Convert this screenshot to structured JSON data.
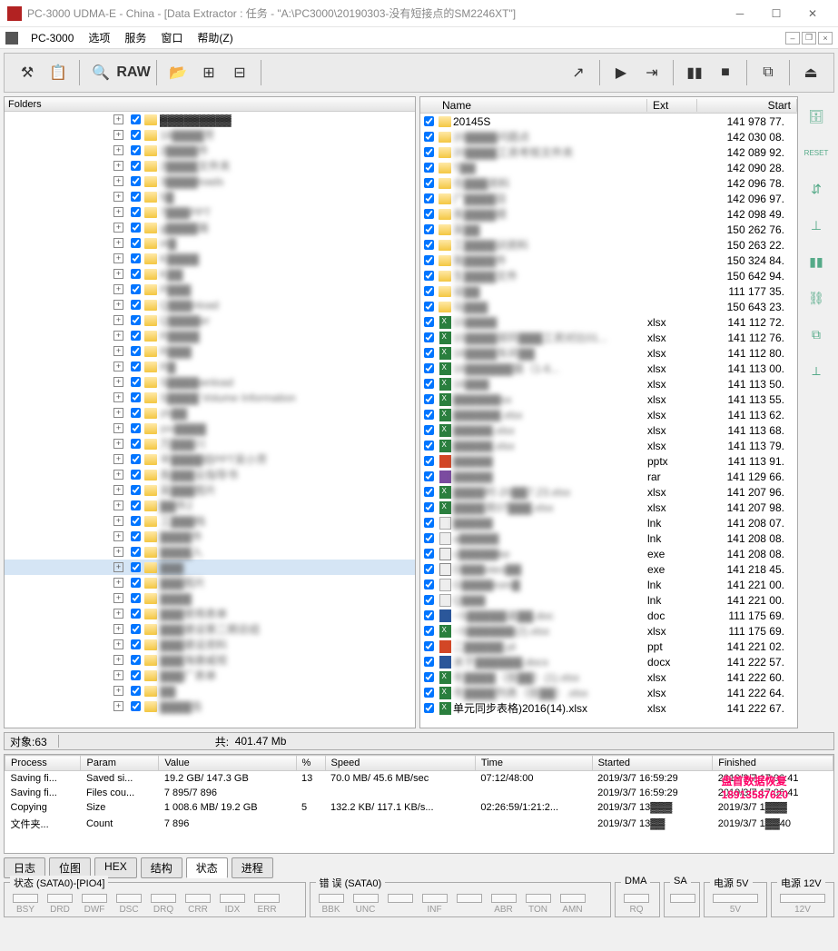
{
  "window": {
    "title": "PC-3000 UDMA-E - China - [Data Extractor : 任务 - \"A:\\PC3000\\20190303-没有短接点的SM2246XT\"]",
    "app_name": "PC-3000"
  },
  "menu": {
    "items": [
      "选项",
      "服务",
      "窗口",
      "帮助(Z)"
    ]
  },
  "toolbar": {
    "raw": "RAW"
  },
  "left_pane": {
    "header": "Folders",
    "rows": [
      {
        "label": "▓▓▓▓▓▓▓▓▓",
        "blur_label": "▓▓年同▓▓▓▓"
      },
      {
        "label": "18▓▓▓▓芳",
        "blur": true
      },
      {
        "label": "2▓▓▓▓件",
        "blur": true
      },
      {
        "label": "2▓▓▓▓文件夹",
        "blur": true
      },
      {
        "label": "3▓▓▓▓loads",
        "blur": true
      },
      {
        "label": "5▓",
        "blur": true
      },
      {
        "label": "7▓▓▓PPT",
        "blur": true
      },
      {
        "label": "g▓▓▓▓端",
        "blur": true
      },
      {
        "label": "i4▓",
        "blur": true
      },
      {
        "label": "K▓▓▓▓",
        "blur": true
      },
      {
        "label": "K▓▓",
        "blur": true
      },
      {
        "label": "P▓▓▓",
        "blur": true
      },
      {
        "label": "Q▓▓▓nload",
        "blur": true
      },
      {
        "label": "Q▓▓▓▓er",
        "blur": true
      },
      {
        "label": "R▓▓▓▓",
        "blur": true
      },
      {
        "label": "R▓▓▓",
        "blur": true
      },
      {
        "label": "R▓",
        "blur": true
      },
      {
        "label": "S▓▓▓▓wnload",
        "blur": true
      },
      {
        "label": "S▓▓▓▓ Volume Information",
        "blur": true
      },
      {
        "label": "zh▓▓",
        "blur": true
      },
      {
        "label": "zm▓▓▓▓",
        "blur": true
      },
      {
        "label": "万▓▓▓川",
        "blur": true
      },
      {
        "label": "半▓▓▓▓结PPT吴小芳",
        "blur": true
      },
      {
        "label": "各▓▓▓业指导书",
        "blur": true
      },
      {
        "label": "吴▓▓▓图片",
        "blur": true
      },
      {
        "label": "▓▓件2",
        "blur": true
      },
      {
        "label": "工▓▓▓档",
        "blur": true
      },
      {
        "label": "▓▓▓▓件",
        "blur": true
      },
      {
        "label": "▓▓▓▓入",
        "blur": true
      },
      {
        "label": "▓▓▓",
        "blur": true,
        "sel": true
      },
      {
        "label": "▓▓▓图片",
        "blur": true
      },
      {
        "label": "▓▓▓▓",
        "blur": true
      },
      {
        "label": "▓▓▓使用表单",
        "blur": true
      },
      {
        "label": "▓▓▓建设第二期总结",
        "blur": true
      },
      {
        "label": "▓▓▓建设资料",
        "blur": true
      },
      {
        "label": "▓▓▓海康威视",
        "blur": true
      },
      {
        "label": "▓▓▓厂表单",
        "blur": true
      },
      {
        "label": "▓▓",
        "blur": true
      },
      {
        "label": "▓▓▓▓告",
        "blur": true
      }
    ]
  },
  "right_pane": {
    "columns": [
      "Name",
      "Ext",
      "Start"
    ],
    "rows": [
      {
        "type": "folder",
        "name": "20145S",
        "ext": "",
        "start": "141 978 77.",
        "blur": false
      },
      {
        "type": "folder",
        "name": "20▓▓▓▓问题点",
        "ext": "",
        "start": "142 030 08.",
        "blur": true
      },
      {
        "type": "folder",
        "name": "20▓▓▓▓工资考核文件夹",
        "ext": "",
        "start": "142 089 92.",
        "blur": true
      },
      {
        "type": "folder",
        "name": "T▓▓",
        "ext": "",
        "start": "142 090 28.",
        "blur": true
      },
      {
        "type": "folder",
        "name": "仓▓▓▓资料",
        "ext": "",
        "start": "142 096 78.",
        "blur": true
      },
      {
        "type": "folder",
        "name": "广▓▓▓▓目",
        "ext": "",
        "start": "142 096 97.",
        "blur": true
      },
      {
        "type": "folder",
        "name": "各▓▓▓▓顺",
        "ext": "",
        "start": "142 098 49.",
        "blur": true
      },
      {
        "type": "folder",
        "name": "吴▓▓",
        "ext": "",
        "start": "150 262 76.",
        "blur": true
      },
      {
        "type": "folder",
        "name": "工▓▓▓▓训资料",
        "ext": "",
        "start": "150 263 22.",
        "blur": true
      },
      {
        "type": "folder",
        "name": "我▓▓▓▓件",
        "ext": "",
        "start": "150 324 84.",
        "blur": true
      },
      {
        "type": "folder",
        "name": "生▓▓▓▓文件",
        "ext": "",
        "start": "150 642 94.",
        "blur": true
      },
      {
        "type": "folder",
        "name": "设▓▓",
        "ext": "",
        "start": "111 177 35.",
        "blur": true
      },
      {
        "type": "folder",
        "name": "马▓▓▓",
        "ext": "",
        "start": "150 643 23.",
        "blur": true
      },
      {
        "type": "xls",
        "name": "15▓▓▓▓",
        "ext": "xlsx",
        "start": "141 112 72.",
        "blur": true
      },
      {
        "type": "xls",
        "name": "15▓▓▓▓部同▓▓▓工资对比01...",
        "ext": "xlsx",
        "start": "141 112 76.",
        "blur": true
      },
      {
        "type": "xls",
        "name": "16▓▓▓▓车间▓▓",
        "ext": "xlsx",
        "start": "141 112 80.",
        "blur": true
      },
      {
        "type": "xls",
        "name": "16▓▓▓▓▓▓据（1-6...",
        "ext": "xlsx",
        "start": "141 113 00.",
        "blur": true
      },
      {
        "type": "xls",
        "name": "16▓▓▓",
        "ext": "xlsx",
        "start": "141 113 50.",
        "blur": true
      },
      {
        "type": "xls",
        "name": "▓▓▓▓▓▓sx",
        "ext": "xlsx",
        "start": "141 113 55.",
        "blur": true
      },
      {
        "type": "xls",
        "name": "▓▓▓▓▓▓.xlsx",
        "ext": "xlsx",
        "start": "141 113 62.",
        "blur": true
      },
      {
        "type": "xls",
        "name": "▓▓▓▓▓.xlsx",
        "ext": "xlsx",
        "start": "141 113 68.",
        "blur": true
      },
      {
        "type": "xls",
        "name": "▓▓▓▓▓.xlsx",
        "ext": "xlsx",
        "start": "141 113 79.",
        "blur": true
      },
      {
        "type": "ppt",
        "name": "▓▓▓▓▓",
        "ext": "pptx",
        "start": "141 113 91.",
        "blur": true
      },
      {
        "type": "rar",
        "name": "▓▓▓▓▓",
        "ext": "rar",
        "start": "141 129 66.",
        "blur": true
      },
      {
        "type": "xls",
        "name": "▓▓▓▓时-20▓▓7.23.xlsx",
        "ext": "xlsx",
        "start": "141 207 96.",
        "blur": true
      },
      {
        "type": "xls",
        "name": "▓▓▓▓资07▓▓▓.xlsx",
        "ext": "xlsx",
        "start": "141 207 98.",
        "blur": true
      },
      {
        "type": "lnk",
        "name": "▓▓▓▓▓",
        "ext": "lnk",
        "start": "141 208 07.",
        "blur": true
      },
      {
        "type": "lnk",
        "name": "a▓▓▓▓▓",
        "ext": "lnk",
        "start": "141 208 08.",
        "blur": true
      },
      {
        "type": "exe",
        "name": "c▓▓▓▓▓ke",
        "ext": "exe",
        "start": "141 208 08.",
        "blur": true
      },
      {
        "type": "exe",
        "name": "D▓▓▓otes▓▓",
        "ext": "exe",
        "start": "141 218 45.",
        "blur": true
      },
      {
        "type": "lnk",
        "name": "G▓▓▓▓rom▓",
        "ext": "lnk",
        "start": "141 221 00.",
        "blur": true
      },
      {
        "type": "lnk",
        "name": "Q▓▓▓",
        "ext": "lnk",
        "start": "141 221 00.",
        "blur": true
      },
      {
        "type": "doc",
        "name": "~S▓▓▓▓▓道▓▓.doc",
        "ext": "doc",
        "start": "111 175 69.",
        "blur": true
      },
      {
        "type": "xls",
        "name": "~S▓▓▓▓▓▓(2).xlsx",
        "ext": "xlsx",
        "start": "111 175 69.",
        "blur": true
      },
      {
        "type": "ppt",
        "name": "二▓▓▓▓▓.pt",
        "ext": "ppt",
        "start": "141 221 02.",
        "blur": true
      },
      {
        "type": "doc",
        "name": "关于▓▓▓▓▓▓.docx",
        "ext": "docx",
        "start": "141 222 57.",
        "blur": true
      },
      {
        "type": "xls",
        "name": "冬▓▓▓▓（技▓▓）(1).xlsx",
        "ext": "xlsx",
        "start": "141 222 60.",
        "blur": true
      },
      {
        "type": "xls",
        "name": "冬▓▓▓▓列表（技▓▓）.xlsx",
        "ext": "xlsx",
        "start": "141 222 64.",
        "blur": true
      },
      {
        "type": "xls",
        "name": "单元同步表格)2016(14).xlsx",
        "ext": "xlsx",
        "start": "141 222 67.",
        "blur": false
      }
    ]
  },
  "status": {
    "objects_label": "对象:63",
    "total_label": "共:",
    "total_value": "401.47 Mb"
  },
  "process": {
    "columns": [
      "Process",
      "Param",
      "Value",
      "%",
      "Speed",
      "Time",
      "Started",
      "Finished"
    ],
    "rows": [
      {
        "process": "Saving fi...",
        "param": "Saved si...",
        "value": "19.2 GB/ 147.3 GB",
        "pct": "13",
        "speed": "70.0 MB/ 45.6 MB/sec",
        "time": "07:12/48:00",
        "started": "2019/3/7 16:59:29",
        "finished": "2019/3/7 17:06:41"
      },
      {
        "process": "Saving fi...",
        "param": "Files cou...",
        "value": "7 895/7 896",
        "pct": "",
        "speed": "",
        "time": "",
        "started": "2019/3/7 16:59:29",
        "finished": "2019/3/7 17:06:41"
      },
      {
        "process": "Copying",
        "param": "Size",
        "value": "1 008.6 MB/ 19.2 GB",
        "pct": "5",
        "speed": "132.2 KB/ 117.1 KB/s...",
        "time": "02:26:59/1:21:2...",
        "started": "2019/3/7 13▓▓▓",
        "finished": "2019/3/7 1▓▓▓"
      },
      {
        "process": "文件夹...",
        "param": "Count",
        "value": "7 896",
        "pct": "",
        "speed": "",
        "time": "",
        "started": "2019/3/7 13▓▓",
        "finished": "2019/3/7 1▓▓40"
      }
    ]
  },
  "tabs": [
    "日志",
    "位图",
    "HEX",
    "结构",
    "状态",
    "进程"
  ],
  "bottom": {
    "status_legend": "状态 (SATA0)-[PIO4]",
    "status_leds": [
      "BSY",
      "DRD",
      "DWF",
      "DSC",
      "DRQ",
      "CRR",
      "IDX",
      "ERR"
    ],
    "error_legend": "错 误 (SATA0)",
    "error_leds": [
      "BBK",
      "UNC",
      "",
      "INF",
      "",
      "ABR",
      "TON",
      "AMN"
    ],
    "dma": "DMA",
    "dma_led": "RQ",
    "sa": "SA",
    "sa_led": "",
    "p5": "电源 5V",
    "p5_led": "5V",
    "p12": "电源 12V",
    "p12_led": "12V"
  },
  "watermark": {
    "line1": "盘首数据恢复",
    "line2": "18913587620"
  }
}
